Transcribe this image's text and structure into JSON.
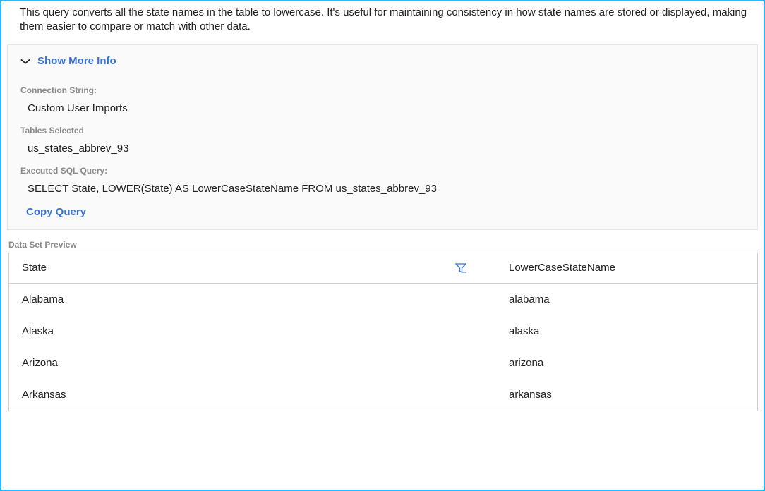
{
  "description": "This query converts all the state names in the table to lowercase. It's useful for maintaining consistency in how state names are stored or displayed, making them easier to compare or match with other data.",
  "show_more_label": "Show More Info",
  "sections": {
    "connection_string_label": "Connection String:",
    "connection_string_value": "Custom User Imports",
    "tables_selected_label": "Tables Selected",
    "tables_selected_value": "us_states_abbrev_93",
    "executed_query_label": "Executed SQL Query:",
    "executed_query_value": "SELECT State, LOWER(State) AS LowerCaseStateName FROM us_states_abbrev_93"
  },
  "copy_query_label": "Copy Query",
  "preview": {
    "label": "Data Set Preview",
    "columns": {
      "col1": "State",
      "col2": "LowerCaseStateName"
    },
    "rows": [
      {
        "state": "Alabama",
        "lower": "alabama"
      },
      {
        "state": "Alaska",
        "lower": "alaska"
      },
      {
        "state": "Arizona",
        "lower": "arizona"
      },
      {
        "state": "Arkansas",
        "lower": "arkansas"
      }
    ]
  }
}
